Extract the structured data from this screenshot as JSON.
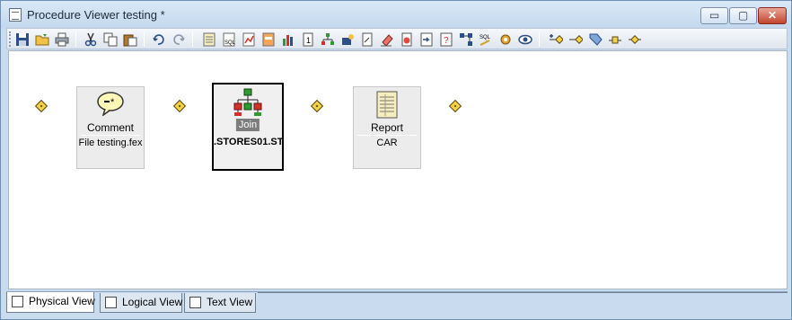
{
  "window": {
    "title": "Procedure Viewer testing *",
    "controls": {
      "minimize": "▭",
      "maximize": "▢",
      "close": "✕"
    }
  },
  "toolbar": {
    "buttons": [
      {
        "name": "save-icon"
      },
      {
        "name": "open-icon"
      },
      {
        "name": "print-icon"
      },
      {
        "name": "cut-icon"
      },
      {
        "name": "copy-icon"
      },
      {
        "name": "paste-icon"
      },
      {
        "name": "undo-icon"
      },
      {
        "name": "redo-icon"
      },
      {
        "name": "report-icon"
      },
      {
        "name": "sql-report-icon"
      },
      {
        "name": "graph-icon"
      },
      {
        "name": "html-form-icon"
      },
      {
        "name": "chart-icon"
      },
      {
        "name": "number-icon"
      },
      {
        "name": "join-icon"
      },
      {
        "name": "define-icon"
      },
      {
        "name": "document-icon"
      },
      {
        "name": "eraser-icon"
      },
      {
        "name": "color-icon"
      },
      {
        "name": "import-icon"
      },
      {
        "name": "help-icon"
      },
      {
        "name": "network-icon"
      },
      {
        "name": "sql-icon"
      },
      {
        "name": "gear-icon"
      },
      {
        "name": "view-icon"
      },
      {
        "name": "add-node-icon"
      },
      {
        "name": "connect-icon"
      },
      {
        "name": "tag-icon"
      },
      {
        "name": "link-icon"
      },
      {
        "name": "diamond-tool-icon"
      }
    ]
  },
  "canvas": {
    "nodes": [
      {
        "type": "comment-icon",
        "label": "Comment",
        "sub": "File testing.fex"
      },
      {
        "type": "join-icon",
        "label": "Join",
        "sub": ".STORES01.ST"
      },
      {
        "type": "report-icon",
        "label": "Report",
        "sub": "CAR"
      }
    ]
  },
  "tabs": [
    {
      "label": "Physical View",
      "active": true,
      "icon": "physical-view-icon"
    },
    {
      "label": "Logical View",
      "active": false,
      "icon": "logical-view-icon"
    },
    {
      "label": "Text View",
      "active": false,
      "icon": "text-view-icon"
    }
  ],
  "colors": {
    "window_frame": "#c9dcef",
    "connector_diamond": "#f3d249",
    "node_fill": "#ececec",
    "close_button": "#c2442d"
  }
}
